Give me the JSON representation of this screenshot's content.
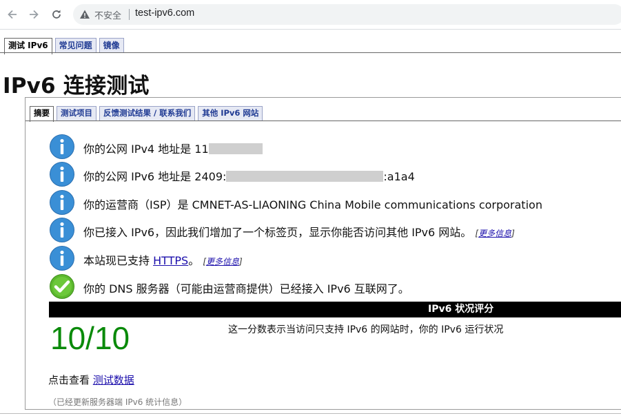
{
  "browser": {
    "security_label": "不安全",
    "url": "test-ipv6.com"
  },
  "site_tabs": [
    {
      "label": "测试 IPv6",
      "active": true
    },
    {
      "label": "常见问题",
      "active": false
    },
    {
      "label": "镜像",
      "active": false
    }
  ],
  "page_title": "IPv6 连接测试",
  "sub_tabs": [
    {
      "label": "摘要",
      "active": true
    },
    {
      "label": "测试项目",
      "active": false
    },
    {
      "label": "反馈测试结果 / 联系我们",
      "active": false
    },
    {
      "label": "其他 IPv6 网站",
      "active": false
    }
  ],
  "results": {
    "ipv4": {
      "prefix": "你的公网 IPv4 地址是 ",
      "visible_value": "11"
    },
    "ipv6": {
      "prefix": "你的公网 IPv6 地址是 ",
      "visible_start": "2409:",
      "visible_end": ":a1a4"
    },
    "isp": {
      "text": "你的运营商（ISP）是 CMNET-AS-LIAONING China Mobile communications corporation"
    },
    "tab_added": {
      "text": "你已接入 IPv6，因此我们增加了一个标签页，显示你能否访问其他 IPv6 网站。",
      "more": "更多信息"
    },
    "https": {
      "prefix": "本站现已支持 ",
      "link": "HTTPS",
      "suffix": "。",
      "more": "更多信息"
    },
    "dns": {
      "text": "你的 DNS 服务器（可能由运营商提供）已经接入 IPv6 互联网了。"
    }
  },
  "score": {
    "header": "IPv6 状况评分",
    "value": "10/10",
    "description": "这一分数表示当访问只支持 IPv6 的网站时，你的 IPv6 运行状况"
  },
  "data_link": {
    "prefix": "点击查看 ",
    "link": "测试数据"
  },
  "stats_note": "（已经更新服务器端 IPv6 统计信息）",
  "colors": {
    "info_blue": "#3a8fd6",
    "ok_green": "#5cb82e",
    "score_green": "#0a8a0a",
    "tab_blue": "#1f3a93"
  }
}
